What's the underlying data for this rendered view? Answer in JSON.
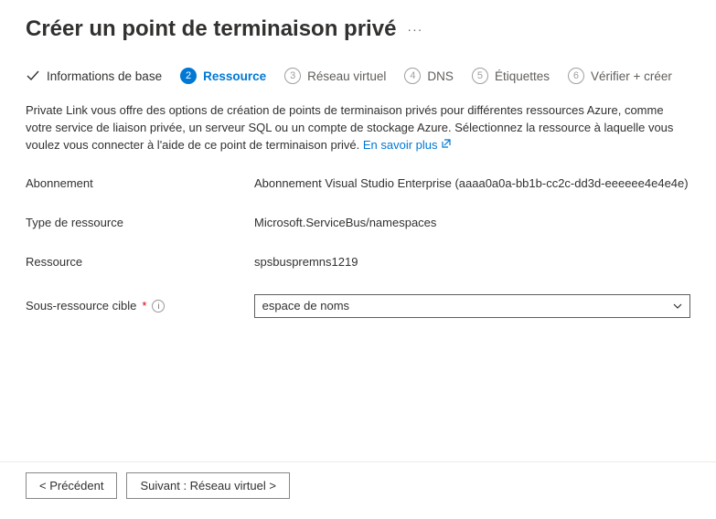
{
  "header": {
    "title": "Créer un point de terminaison privé",
    "ellipsis": "···"
  },
  "tabs": {
    "t1": {
      "label": "Informations de base"
    },
    "t2": {
      "label": "Ressource",
      "num": "2"
    },
    "t3": {
      "label": "Réseau virtuel",
      "num": "3"
    },
    "t4": {
      "label": "DNS",
      "num": "4"
    },
    "t5": {
      "label": "Étiquettes",
      "num": "5"
    },
    "t6": {
      "label": "Vérifier + créer",
      "num": "6"
    }
  },
  "desc": {
    "text": "Private Link vous offre des options de création de points de terminaison privés pour différentes ressources Azure, comme votre service de liaison privée, un serveur SQL ou un compte de stockage Azure. Sélectionnez la ressource à laquelle vous voulez vous connecter à l'aide de ce point de terminaison privé. ",
    "link": "En savoir plus"
  },
  "form": {
    "subscription": {
      "label": "Abonnement",
      "value": "Abonnement Visual Studio Enterprise (aaaa0a0a-bb1b-cc2c-dd3d-eeeeee4e4e4e)"
    },
    "resourceType": {
      "label": "Type de ressource",
      "value": "Microsoft.ServiceBus/namespaces"
    },
    "resource": {
      "label": "Ressource",
      "value": "spsbuspremns1219"
    },
    "subresource": {
      "label": "Sous-ressource cible",
      "required": "*",
      "value": "espace de noms"
    }
  },
  "buttons": {
    "prev": "< Précédent",
    "next": "Suivant : Réseau virtuel >"
  }
}
